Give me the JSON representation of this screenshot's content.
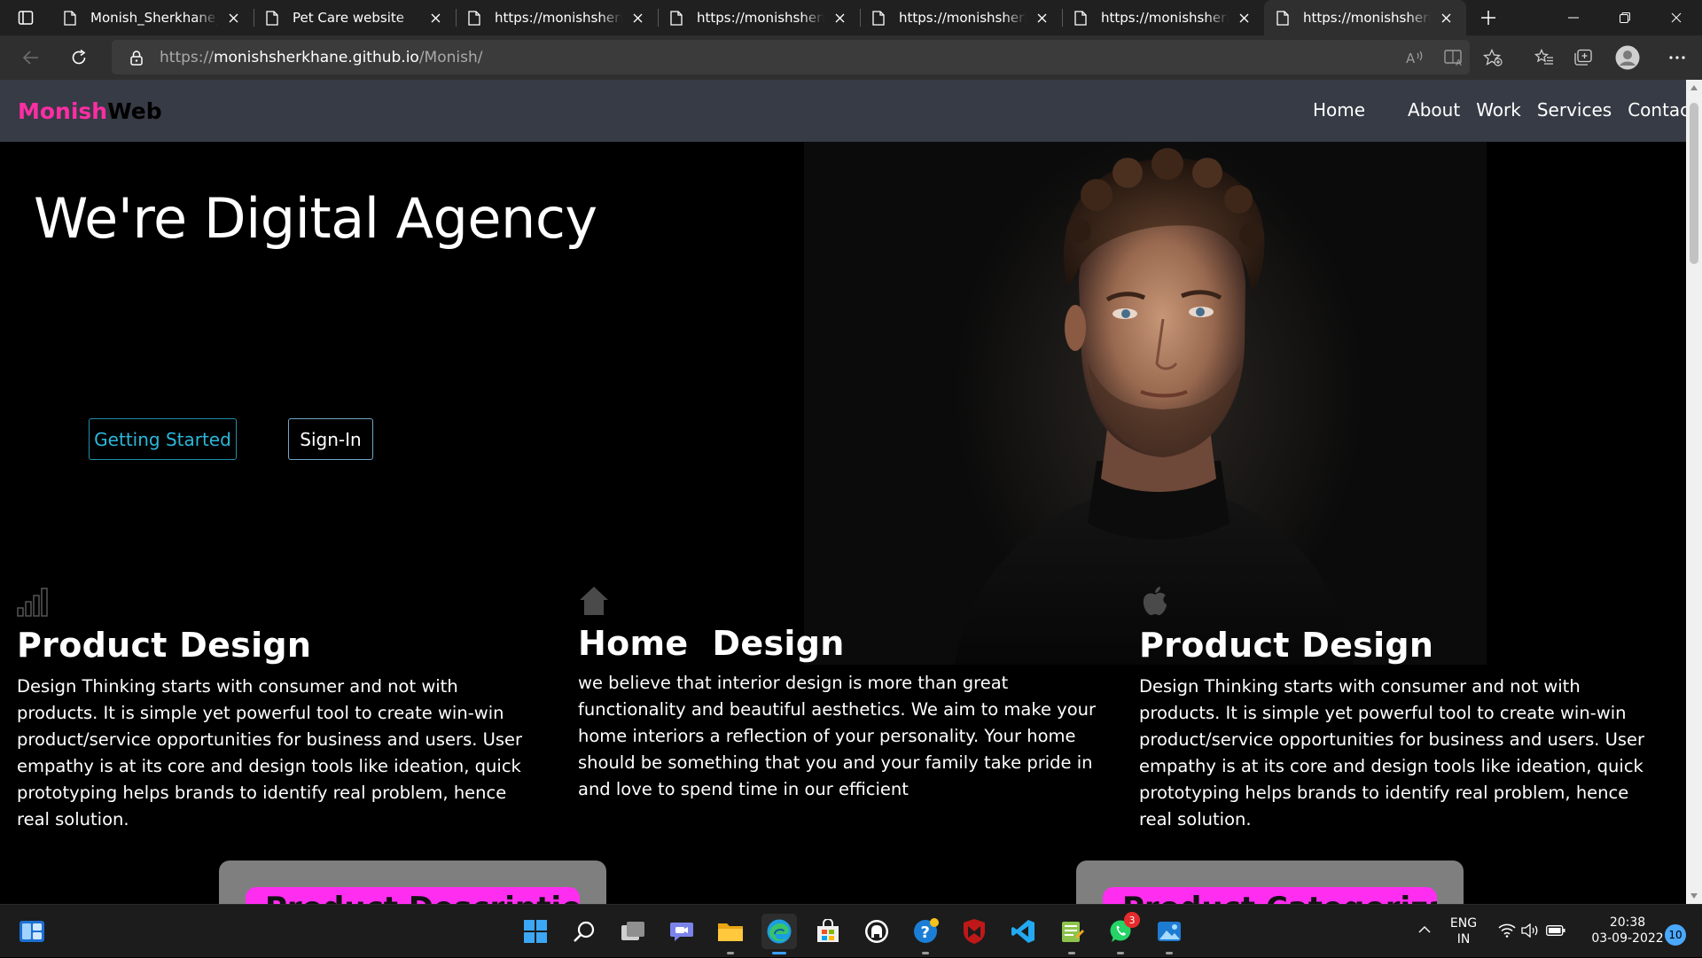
{
  "browser": {
    "tabs": [
      {
        "title": "Monish_Sherkhane_portfolio",
        "active": false
      },
      {
        "title": "Pet Care website",
        "active": false
      },
      {
        "title": "https://monishsherkhane.github.io",
        "active": false
      },
      {
        "title": "https://monishsherkhane.github.io",
        "active": false
      },
      {
        "title": "https://monishsherkhane.github.io",
        "active": false
      },
      {
        "title": "https://monishsherkhane.github.io",
        "active": false
      },
      {
        "title": "https://monishsherkhane.github.io",
        "active": true
      }
    ],
    "url_prefix": "https://",
    "url_host": "monishsherkhane.github.io",
    "url_path": "/Monish/"
  },
  "site": {
    "logo_part1": "Monish",
    "logo_part2": "Web",
    "nav": [
      "Home",
      "About",
      "Work",
      "Services",
      "Contact"
    ],
    "hero_title": "We're Digital Agency",
    "btn_start": "Getting Started",
    "btn_sign": "Sign-In",
    "features": [
      {
        "icon": "bar-chart-icon",
        "title": "Product Design",
        "text": "Design Thinking starts with consumer and not with products. It is simple yet powerful tool to create win-win product/service opportunities for business and users. User empathy is at its core and design tools like ideation, quick prototyping helps brands to identify real problem, hence real solution."
      },
      {
        "icon": "home-icon",
        "title": "Home  Design",
        "text": "we believe that interior design is more than great functionality and beautiful aesthetics. We aim to make your home interiors a reflection of your personality. Your home should be something that you and your family take pride in and love to spend time in our efficient"
      },
      {
        "icon": "apple-icon",
        "title": "Product Design",
        "text": "Design Thinking starts with consumer and not with products. It is simple yet powerful tool to create win-win product/service opportunities for business and users. User empathy is at its core and design tools like ideation, quick prototyping helps brands to identify real problem, hence real solution."
      }
    ],
    "cards": [
      "Product Descriptions",
      "Product Categorization"
    ]
  },
  "taskbar": {
    "apps": [
      "start",
      "search",
      "task-view",
      "teams-chat",
      "file-explorer",
      "edge",
      "store",
      "github-desktop",
      "mail-help",
      "mcafee",
      "vscode",
      "notepad",
      "whatsapp",
      "photos"
    ],
    "whatsapp_badge": "3",
    "lang_line1": "ENG",
    "lang_line2": "IN",
    "time": "20:38",
    "date": "03-09-2022",
    "notifications": "10"
  },
  "colors": {
    "accent_pink": "#ff2da4",
    "nav_bg": "#363b45",
    "start_btn": "#2bb7d9"
  }
}
